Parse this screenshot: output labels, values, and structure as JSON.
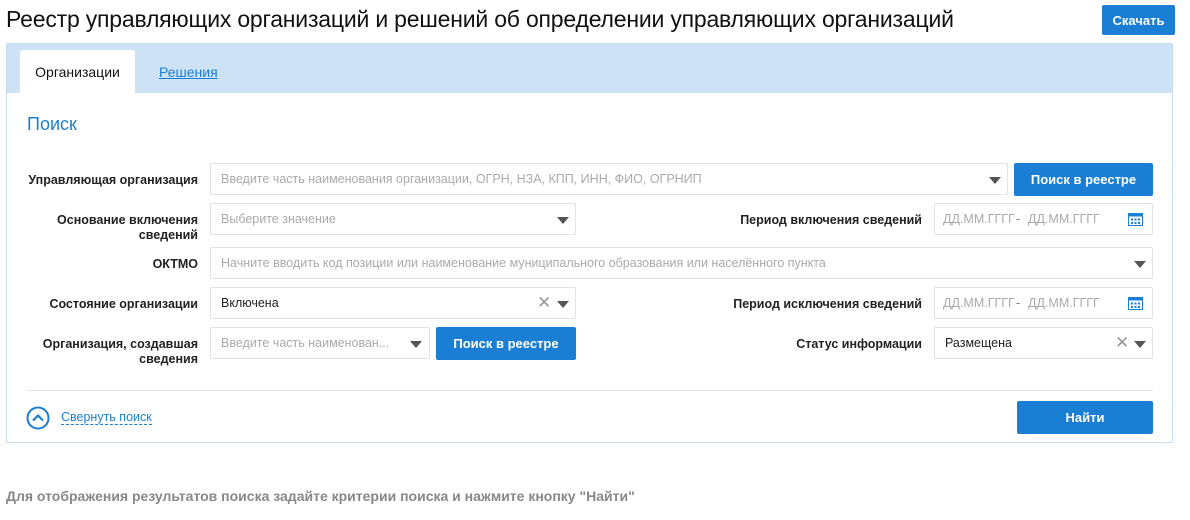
{
  "header": {
    "title": "Реестр управляющих организаций и решений об определении управляющих организаций",
    "download_label": "Скачать"
  },
  "tabs": [
    {
      "label": "Организации",
      "active": true
    },
    {
      "label": "Решения",
      "active": false
    }
  ],
  "search": {
    "title": "Поиск",
    "org_label": "Управляющая организация",
    "org_placeholder": "Введите часть наименования организации, ОГРН, НЗА, КПП, ИНН, ФИО, ОГРНИП",
    "registry_search_label": "Поиск в реестре",
    "basis_label": "Основание включения сведений",
    "basis_placeholder": "Выберите значение",
    "inclusion_period_label": "Период включения сведений",
    "date_placeholder": "ДД.ММ.ГГГГ",
    "date_separator": "-",
    "oktmo_label": "ОКТМО",
    "oktmo_placeholder": "Начните вводить код позиции или наименование муниципального образования или населённого пункта",
    "state_label": "Состояние организации",
    "state_value": "Включена",
    "exclusion_period_label": "Период исключения сведений",
    "creator_label": "Организация, создавшая сведения",
    "creator_placeholder": "Введите часть наименован...",
    "info_status_label": "Статус информации",
    "info_status_value": "Размещена",
    "collapse_label": "Свернуть поиск",
    "find_label": "Найти"
  },
  "hint": "Для отображения результатов поиска задайте критерии поиска и нажмите кнопку \"Найти\"",
  "colors": {
    "accent": "#1a7fd4",
    "tabbar": "#cde3f5"
  }
}
